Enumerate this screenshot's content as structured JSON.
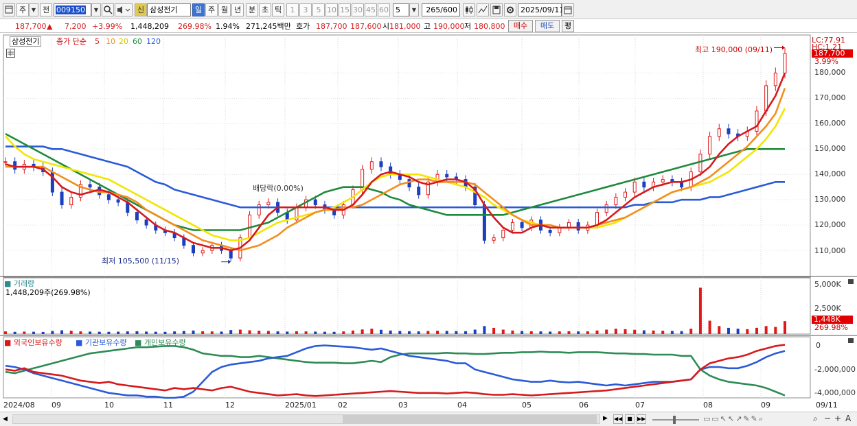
{
  "toolbar": {
    "mode": "주",
    "type": "전",
    "code": "009150",
    "name_badge": "신",
    "name": "삼성전기",
    "periods": [
      "일",
      "주",
      "월",
      "년",
      "분",
      "초",
      "틱"
    ],
    "intervals": [
      "1",
      "3",
      "5",
      "10",
      "15",
      "30",
      "45",
      "60"
    ],
    "custom_interval": "5",
    "count": "265",
    "count_max": "/600",
    "date": "2025/09/11"
  },
  "quote": {
    "price": "187,700",
    "change": "7,200",
    "change_pct": "+3.99%",
    "volume": "1,448,209",
    "volume_pct": "269.98%",
    "turnover_pct": "1.94%",
    "amount": "271,245백만",
    "bid_label": "호가",
    "bid1": "187,700",
    "bid2": "187,600",
    "open_label": "시",
    "open": "181,000",
    "high_label": "고",
    "high": "190,000",
    "low_label": "저",
    "low": "180,800",
    "buy": "매수",
    "sell": "매도",
    "avg": "평"
  },
  "price_panel": {
    "stock": "삼성전기",
    "legend_prefix": "종가 단순",
    "ma": [
      {
        "period": "5",
        "color": "#d7191c"
      },
      {
        "period": "10",
        "color": "#f28e1c"
      },
      {
        "period": "20",
        "color": "#f2e600"
      },
      {
        "period": "60",
        "color": "#1f8a3b"
      },
      {
        "period": "120",
        "color": "#2a5bd7"
      }
    ],
    "lc": "LC:77.91",
    "hc": "HC:1.21",
    "last": "187,700",
    "last_pct": "3.99%",
    "y_ticks": [
      "180,000",
      "170,000",
      "160,000",
      "150,000",
      "140,000",
      "130,000",
      "120,000",
      "110,000"
    ],
    "high_note": "최고 190,000 (09/11)",
    "low_note": "최저 105,500 (11/15)",
    "div_note": "배당락(0.00%)"
  },
  "volume_panel": {
    "title": "거래량",
    "value": "1,448,209주(269.98%)",
    "y_ticks": [
      "5,000K",
      "2,500K"
    ],
    "last": "1,448K",
    "last_pct": "269.98%"
  },
  "holding_panel": {
    "legend": [
      "외국인보유수량",
      "기관보유수량",
      "개인보유수량"
    ],
    "colors": [
      "#d7191c",
      "#2a5bd7",
      "#2e8b57"
    ],
    "y_ticks": [
      "0",
      "-2,000,000",
      "-4,000,000"
    ]
  },
  "x_labels": [
    "2024/08",
    "09",
    "10",
    "11",
    "12",
    "2025/01",
    "02",
    "03",
    "04",
    "05",
    "06",
    "07",
    "08",
    "09",
    "09/11"
  ],
  "chart_data": {
    "type": "line",
    "price_ylim": [
      100000,
      195000
    ],
    "close": [
      145000,
      142000,
      144000,
      143000,
      141000,
      133000,
      128000,
      131000,
      136000,
      135000,
      132000,
      130000,
      129000,
      125000,
      122000,
      120000,
      118000,
      117000,
      115000,
      112000,
      109000,
      110000,
      112000,
      110000,
      107000,
      115000,
      124000,
      128000,
      129000,
      125000,
      122000,
      127000,
      130000,
      128000,
      126000,
      124000,
      128000,
      134000,
      142000,
      145000,
      143000,
      140000,
      138000,
      135000,
      132000,
      137000,
      140000,
      139000,
      138000,
      135000,
      128000,
      114000,
      115000,
      118000,
      121000,
      119000,
      122000,
      118000,
      117000,
      119000,
      121000,
      118000,
      120000,
      125000,
      128000,
      131000,
      133000,
      137000,
      135000,
      137000,
      138000,
      137000,
      135000,
      141000,
      148000,
      155000,
      158000,
      156000,
      155000,
      157000,
      165000,
      175000,
      180000,
      187700
    ],
    "ma5": [
      144000,
      143000,
      143000,
      143000,
      142000,
      139000,
      135000,
      133000,
      132000,
      133000,
      134000,
      133000,
      131000,
      129000,
      126000,
      123000,
      120000,
      118000,
      117000,
      115000,
      113000,
      112000,
      111000,
      111000,
      110000,
      111000,
      114000,
      119000,
      124000,
      127000,
      127000,
      127000,
      127000,
      127000,
      127000,
      126000,
      126000,
      128000,
      132000,
      137000,
      140000,
      141000,
      140000,
      139000,
      137000,
      136000,
      137000,
      138000,
      138000,
      137000,
      134000,
      128000,
      123000,
      119000,
      117000,
      117000,
      119000,
      120000,
      119000,
      119000,
      119000,
      119000,
      119000,
      120000,
      122000,
      125000,
      128000,
      131000,
      133000,
      135000,
      136000,
      137000,
      137000,
      138000,
      140000,
      143000,
      148000,
      152000,
      155000,
      157000,
      159000,
      165000,
      171000,
      180000
    ],
    "ma10": [
      143000,
      143000,
      143000,
      143000,
      143000,
      141000,
      139000,
      137000,
      135000,
      134000,
      133000,
      133000,
      132000,
      131000,
      129000,
      126000,
      124000,
      122000,
      120000,
      118000,
      116000,
      114000,
      113000,
      112000,
      111000,
      110000,
      111000,
      112000,
      114000,
      116000,
      119000,
      121000,
      123000,
      125000,
      126000,
      126000,
      127000,
      127000,
      128000,
      130000,
      132000,
      134000,
      136000,
      137000,
      138000,
      138000,
      137000,
      137000,
      137000,
      137000,
      136000,
      133000,
      130000,
      127000,
      124000,
      122000,
      120000,
      120000,
      120000,
      119000,
      119000,
      119000,
      119000,
      120000,
      121000,
      122000,
      123000,
      125000,
      127000,
      129000,
      131000,
      133000,
      134000,
      135000,
      137000,
      139000,
      142000,
      145000,
      148000,
      151000,
      155000,
      159000,
      164000,
      174000
    ],
    "ma20": [
      155000,
      151000,
      148000,
      146000,
      145000,
      144000,
      143000,
      142000,
      141000,
      140000,
      139000,
      138000,
      136000,
      134000,
      132000,
      130000,
      128000,
      126000,
      124000,
      122000,
      120000,
      118000,
      116000,
      115000,
      114000,
      114000,
      115000,
      117000,
      119000,
      121000,
      122000,
      123000,
      124000,
      125000,
      126000,
      127000,
      129000,
      131000,
      134000,
      137000,
      139000,
      140000,
      140000,
      140000,
      140000,
      139000,
      138000,
      137000,
      136000,
      135000,
      133000,
      131000,
      128000,
      126000,
      124000,
      122000,
      121000,
      120000,
      119000,
      119000,
      119000,
      119000,
      119000,
      119000,
      120000,
      121000,
      123000,
      125000,
      127000,
      129000,
      131000,
      133000,
      134000,
      135000,
      136000,
      137000,
      139000,
      141000,
      144000,
      147000,
      150000,
      154000,
      159000,
      166000
    ],
    "ma60": [
      156000,
      154000,
      152000,
      150000,
      148000,
      146000,
      144000,
      142000,
      140000,
      138000,
      136000,
      134000,
      132000,
      130000,
      128000,
      126000,
      124000,
      122000,
      120000,
      119000,
      118000,
      118000,
      118000,
      118000,
      118000,
      118000,
      119000,
      120000,
      121000,
      123000,
      125000,
      127000,
      129000,
      131000,
      133000,
      134000,
      135000,
      135000,
      135000,
      134000,
      133000,
      131000,
      130000,
      128000,
      127000,
      126000,
      125000,
      124000,
      124000,
      124000,
      124000,
      124000,
      124000,
      124000,
      125000,
      126000,
      127000,
      128000,
      129000,
      130000,
      131000,
      132000,
      133000,
      134000,
      135000,
      136000,
      137000,
      138000,
      139000,
      140000,
      141000,
      142000,
      143000,
      144000,
      145000,
      146000,
      147000,
      148000,
      149000,
      150000,
      150000,
      150000,
      150000,
      150000
    ],
    "ma120": [
      151000,
      151000,
      151000,
      151000,
      151000,
      150000,
      150000,
      149000,
      148000,
      147000,
      146000,
      145000,
      144000,
      143000,
      141000,
      139000,
      137000,
      136000,
      134000,
      133000,
      132000,
      131000,
      130000,
      129000,
      128000,
      127000,
      127000,
      127000,
      127000,
      127000,
      127000,
      127000,
      127000,
      127000,
      127000,
      127000,
      127000,
      127000,
      127000,
      127000,
      127000,
      127000,
      127000,
      127000,
      127000,
      127000,
      127000,
      127000,
      127000,
      127000,
      127000,
      127000,
      127000,
      127000,
      127000,
      127000,
      127000,
      127000,
      127000,
      127000,
      127000,
      127000,
      127000,
      127000,
      127000,
      127000,
      127000,
      128000,
      128000,
      129000,
      129000,
      129000,
      130000,
      130000,
      130000,
      131000,
      131000,
      132000,
      133000,
      134000,
      135000,
      136000,
      137000,
      137000
    ],
    "volume_k": [
      300,
      250,
      280,
      260,
      240,
      350,
      420,
      380,
      300,
      280,
      260,
      250,
      270,
      300,
      320,
      280,
      260,
      250,
      300,
      350,
      400,
      320,
      300,
      280,
      450,
      500,
      420,
      380,
      350,
      300,
      280,
      320,
      300,
      280,
      260,
      250,
      300,
      400,
      520,
      600,
      480,
      400,
      350,
      320,
      300,
      350,
      380,
      360,
      340,
      320,
      500,
      900,
      700,
      500,
      400,
      350,
      320,
      300,
      280,
      300,
      320,
      300,
      310,
      400,
      500,
      600,
      550,
      480,
      420,
      400,
      380,
      350,
      330,
      600,
      5200,
      1500,
      900,
      700,
      600,
      550,
      700,
      900,
      800,
      1448
    ],
    "volume_ylim": [
      0,
      6000
    ],
    "foreign": [
      -2000000,
      -2100000,
      -1900000,
      -2200000,
      -2300000,
      -2400000,
      -2500000,
      -2700000,
      -2900000,
      -3000000,
      -3100000,
      -3000000,
      -3200000,
      -3300000,
      -3400000,
      -3500000,
      -3600000,
      -3700000,
      -3500000,
      -3600000,
      -3500000,
      -3600000,
      -3700000,
      -3500000,
      -3400000,
      -3600000,
      -3800000,
      -3900000,
      -4000000,
      -4100000,
      -4050000,
      -4000000,
      -4100000,
      -4150000,
      -4100000,
      -4050000,
      -4000000,
      -3950000,
      -3900000,
      -3850000,
      -3800000,
      -3750000,
      -3800000,
      -3850000,
      -3900000,
      -3900000,
      -3900000,
      -3950000,
      -3900000,
      -3850000,
      -3900000,
      -4000000,
      -4050000,
      -4050000,
      -4000000,
      -4050000,
      -4100000,
      -4050000,
      -4000000,
      -3950000,
      -3900000,
      -3850000,
      -3800000,
      -3750000,
      -3700000,
      -3600000,
      -3500000,
      -3400000,
      -3300000,
      -3200000,
      -3100000,
      -3000000,
      -2900000,
      -2800000,
      -2000000,
      -1500000,
      -1300000,
      -1100000,
      -1000000,
      -800000,
      -500000,
      -300000,
      -100000,
      0
    ],
    "institution": [
      -1700000,
      -1800000,
      -2000000,
      -2300000,
      -2500000,
      -2700000,
      -2900000,
      -3100000,
      -3300000,
      -3500000,
      -3700000,
      -3900000,
      -4000000,
      -4100000,
      -4100000,
      -4200000,
      -4200000,
      -4300000,
      -4300000,
      -4200000,
      -3800000,
      -3000000,
      -2200000,
      -1800000,
      -1600000,
      -1500000,
      -1400000,
      -1300000,
      -1100000,
      -1000000,
      -900000,
      -600000,
      -300000,
      -100000,
      -50000,
      -100000,
      -150000,
      -200000,
      -300000,
      -400000,
      -300000,
      -500000,
      -700000,
      -900000,
      -1000000,
      -1100000,
      -1200000,
      -1300000,
      -1500000,
      -1500000,
      -2000000,
      -2200000,
      -2400000,
      -2600000,
      -2800000,
      -2900000,
      -3000000,
      -3000000,
      -2900000,
      -3000000,
      -3050000,
      -3000000,
      -3100000,
      -3200000,
      -3300000,
      -3200000,
      -3300000,
      -3200000,
      -3100000,
      -3000000,
      -3000000,
      -3000000,
      -2900000,
      -2800000,
      -2000000,
      -1800000,
      -1800000,
      -1900000,
      -1900000,
      -1700000,
      -1400000,
      -1000000,
      -700000,
      -500000
    ],
    "individual": [
      -2200000,
      -2300000,
      -2100000,
      -1900000,
      -1700000,
      -1500000,
      -1300000,
      -1100000,
      -900000,
      -700000,
      -600000,
      -500000,
      -400000,
      -300000,
      -200000,
      -200000,
      -150000,
      -100000,
      -100000,
      -200000,
      -400000,
      -700000,
      -800000,
      -900000,
      -900000,
      -1000000,
      -1000000,
      -900000,
      -1000000,
      -1100000,
      -1200000,
      -1300000,
      -1400000,
      -1450000,
      -1450000,
      -1450000,
      -1500000,
      -1500000,
      -1400000,
      -1300000,
      -1400000,
      -1000000,
      -800000,
      -700000,
      -700000,
      -700000,
      -700000,
      -650000,
      -700000,
      -700000,
      -750000,
      -750000,
      -700000,
      -650000,
      -650000,
      -600000,
      -600000,
      -550000,
      -600000,
      -600000,
      -650000,
      -600000,
      -600000,
      -600000,
      -650000,
      -700000,
      -700000,
      -750000,
      -750000,
      -800000,
      -800000,
      -800000,
      -900000,
      -900000,
      -2000000,
      -2500000,
      -2800000,
      -3000000,
      -3100000,
      -3200000,
      -3300000,
      -3500000,
      -3800000,
      -4100000
    ],
    "holding_ylim": [
      -4300000,
      200000
    ]
  }
}
